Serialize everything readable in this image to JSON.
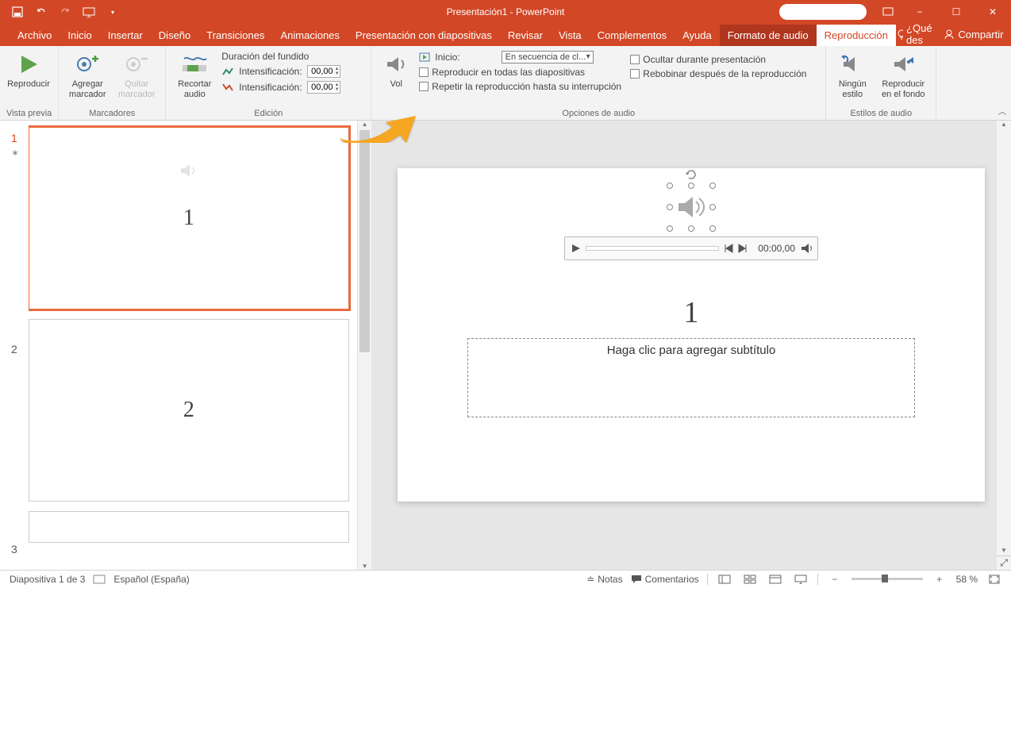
{
  "titlebar": {
    "title": "Presentación1 - PowerPoint",
    "qat_save": "💾",
    "qat_undo": "↶",
    "qat_redo": "↷",
    "qat_start": "▦"
  },
  "window_buttons": {
    "ribbon_options": "▭",
    "minimize": "−",
    "maximize": "☐",
    "close": "✕"
  },
  "tabs": {
    "file": "Archivo",
    "home": "Inicio",
    "insert": "Insertar",
    "design": "Diseño",
    "transitions": "Transiciones",
    "animations": "Animaciones",
    "slideshow": "Presentación con diapositivas",
    "review": "Revisar",
    "view": "Vista",
    "addins": "Complementos",
    "help": "Ayuda",
    "format_audio": "Formato de audio",
    "playback": "Reproducción"
  },
  "tabrow_right": {
    "tell_me": "¿Qué des",
    "share": "Compartir"
  },
  "ribbon": {
    "preview_group": "Vista previa",
    "preview_btn": "Reproducir",
    "bookmarks_group": "Marcadores",
    "add_bookmark": "Agregar marcador",
    "remove_bookmark": "Quitar marcador",
    "editing_group": "Edición",
    "trim_audio": "Recortar audio",
    "fade_duration": "Duración del fundido",
    "fade_in": "Intensificación:",
    "fade_out": "Intensificación:",
    "fade_in_val": "00,00",
    "fade_out_val": "00,00",
    "volume": "Vol",
    "audio_options_group": "Opciones de audio",
    "start_label": "Inicio:",
    "start_value": "En secuencia de cl...",
    "play_across": "Reproducir en todas las diapositivas",
    "loop_until": "Repetir la reproducción hasta su interrupción",
    "hide_during": "Ocultar durante presentación",
    "rewind_after": "Rebobinar después de la reproducción",
    "audio_styles_group": "Estilos de audio",
    "no_style": "Ningún estilo",
    "play_background": "Reproducir en el fondo"
  },
  "thumbs": {
    "n1": "1",
    "n2": "2",
    "n3": "3",
    "title1": "1",
    "title2": "2"
  },
  "slide": {
    "title": "1",
    "subtitle_placeholder": "Haga clic para agregar subtítulo",
    "time": "00:00,00"
  },
  "status": {
    "slide_count": "Diapositiva 1 de 3",
    "language": "Español (España)",
    "notes": "Notas",
    "comments": "Comentarios",
    "zoom": "58 %"
  }
}
